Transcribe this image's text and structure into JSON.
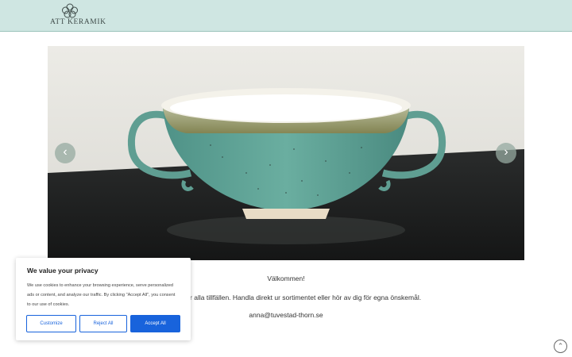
{
  "header": {
    "logo_text": "ATT KERAMIK",
    "logo_icon": "flower-icon",
    "background": "#cfe6e2"
  },
  "slider": {
    "image": "turquoise-ceramic-bowl-with-handles",
    "prev_icon": "chevron-left-icon",
    "next_icon": "chevron-right-icon",
    "prev_glyph": "‹",
    "next_glyph": "›"
  },
  "main": {
    "welcome": "Välkommen!",
    "intro": "rd keramik för alla tillfällen. Handla direkt ur sortimentet eller hör av dig för egna önskemål.",
    "email": "anna@tuvestad-thorn.se"
  },
  "cookie_banner": {
    "title": "We value your privacy",
    "text": "We use cookies to enhance your browsing experience, serve personalized ads or content, and analyze our traffic. By clicking \"Accept All\", you consent to our use of cookies.",
    "customize_label": "Customize",
    "reject_label": "Reject All",
    "accept_label": "Accept All",
    "accent_color": "#1863dc"
  },
  "scroll_top": {
    "icon": "arrow-up-circle-icon",
    "glyph": "⌃"
  }
}
